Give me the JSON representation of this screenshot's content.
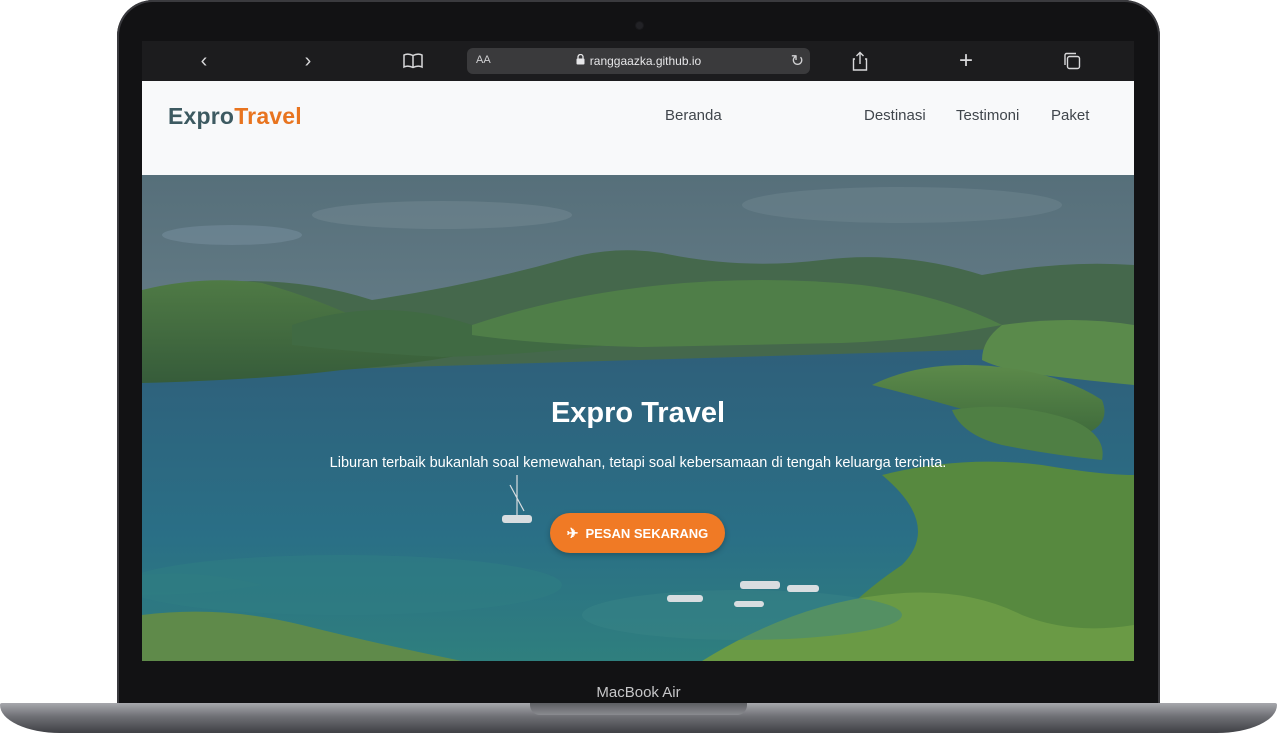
{
  "device": {
    "label": "MacBook Air"
  },
  "browser": {
    "back_icon": "chevron-left-icon",
    "forward_icon": "chevron-right-icon",
    "reader_icon": "book-icon",
    "text_size_label": "AA",
    "url": "ranggaazka.github.io",
    "lock_icon": "lock-icon",
    "reload_icon": "reload-icon",
    "share_icon": "share-icon",
    "new_tab_icon": "plus-icon",
    "tabs_icon": "tabs-icon"
  },
  "site": {
    "logo_part1": "Expro",
    "logo_part2": "Travel",
    "nav": [
      {
        "label": "Beranda"
      },
      {
        "label": "Destinasi"
      },
      {
        "label": "Testimoni"
      },
      {
        "label": "Paket"
      }
    ]
  },
  "hero": {
    "title": "Expro Travel",
    "subtitle": "Liburan terbaik bukanlah soal kemewahan, tetapi soal kebersamaan di tengah keluarga tercinta.",
    "cta_label": "PESAN SEKARANG",
    "cta_icon": "plane-icon"
  },
  "colors": {
    "brand_dark": "#3d5a61",
    "brand_accent": "#e8741f",
    "cta": "#f07a25"
  }
}
